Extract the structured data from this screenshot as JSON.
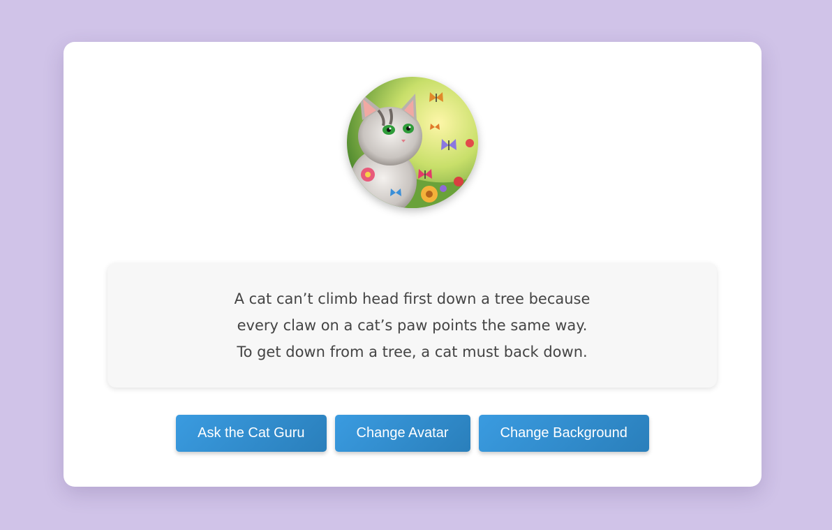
{
  "avatar": {
    "icon": "cat-avatar-image"
  },
  "fact": {
    "text": "A cat can’t climb head first down a tree because every claw on a cat’s paw points the same way. To get down from a tree, a cat must back down."
  },
  "buttons": {
    "ask_label": "Ask the Cat Guru",
    "avatar_label": "Change Avatar",
    "background_label": "Change Background"
  },
  "colors": {
    "page_background": "#d0c3e8",
    "card_background": "#ffffff",
    "button_start": "#3a9be0",
    "button_end": "#2a7fbb"
  }
}
